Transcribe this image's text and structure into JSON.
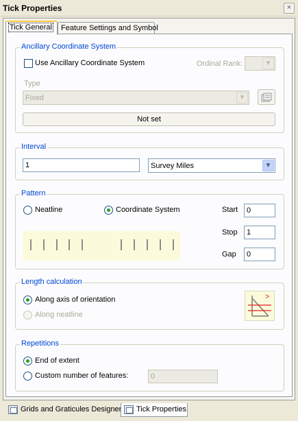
{
  "window": {
    "title": "Tick Properties",
    "close_glyph": "×"
  },
  "tabs": [
    {
      "label": "Tick General",
      "active": true
    },
    {
      "label": "Feature Settings and Symbol",
      "active": false
    }
  ],
  "ancillary": {
    "legend": "Ancillary Coordinate System",
    "use_checkbox_label": "Use Ancillary Coordinate System",
    "use_checked": false,
    "ordinal_rank_label": "Ordinal Rank:",
    "ordinal_rank_value": "",
    "type_label": "Type",
    "type_value": "Fixed",
    "not_set_label": "Not set",
    "properties_icon": "properties-icon"
  },
  "interval": {
    "legend": "Interval",
    "value": "1",
    "unit": "Survey Miles"
  },
  "pattern": {
    "legend": "Pattern",
    "options": [
      {
        "label": "Neatline",
        "checked": false
      },
      {
        "label": "Coordinate System",
        "checked": true
      }
    ],
    "start_label": "Start",
    "start_value": "0",
    "stop_label": "Stop",
    "stop_value": "1",
    "gap_label": "Gap",
    "gap_value": "0"
  },
  "length": {
    "legend": "Length calculation",
    "options": [
      {
        "label": "Along axis of orientation",
        "checked": true,
        "enabled": true
      },
      {
        "label": "Along neatline",
        "checked": false,
        "enabled": false
      }
    ],
    "icon": "length-orientation-icon",
    "icon_mark": ">"
  },
  "repetitions": {
    "legend": "Repetitions",
    "options": [
      {
        "label": "End of extent",
        "checked": true
      },
      {
        "label": "Custom number of features:",
        "checked": false
      }
    ],
    "custom_value": "0"
  },
  "bottom_tabs": [
    {
      "label": "Grids and Graticules Designer",
      "active": false
    },
    {
      "label": "Tick Properties",
      "active": true
    }
  ],
  "colors": {
    "accent_legend": "#0046d5",
    "radio_dot": "#21a121",
    "active_tab_top": "#ffc83c",
    "preview_bg": "#fbfbdc",
    "icon_red": "#e02020"
  }
}
